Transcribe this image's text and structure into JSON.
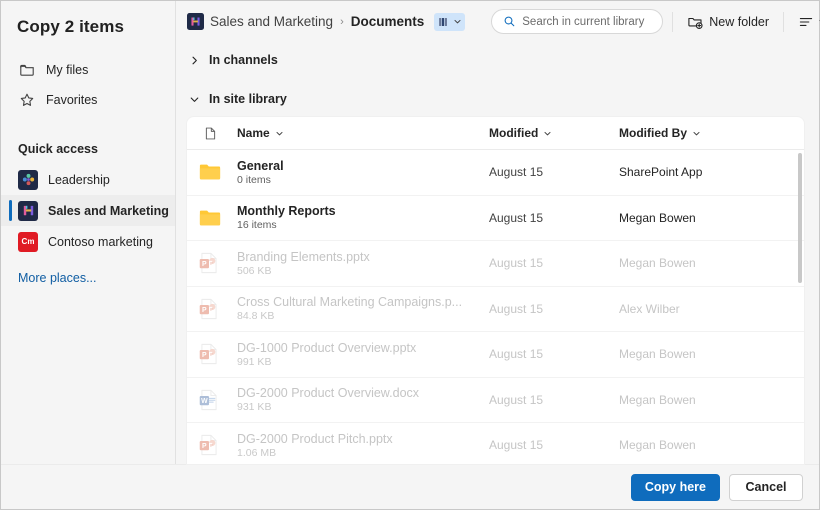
{
  "dialog": {
    "title": "Copy 2 items"
  },
  "sidebar": {
    "nav": [
      {
        "label": "My files",
        "icon": "folder-icon"
      },
      {
        "label": "Favorites",
        "icon": "star-icon"
      }
    ],
    "quick_access_label": "Quick access",
    "quick_access": [
      {
        "label": "Leadership",
        "icon": "team-avatar-leadership",
        "selected": false
      },
      {
        "label": "Sales and Marketing",
        "icon": "team-avatar-sales-marketing",
        "selected": true
      },
      {
        "label": "Contoso marketing",
        "icon": "team-avatar-contoso",
        "initials": "Cm",
        "selected": false
      }
    ],
    "more_places": "More places..."
  },
  "toolbar": {
    "breadcrumb": {
      "site": "Sales and Marketing",
      "separator": "›",
      "current": "Documents",
      "library_switcher_icon": "library-icon",
      "library_chevron_icon": "chevron-down-icon"
    },
    "search": {
      "placeholder": "Search in current library",
      "value": "",
      "icon": "search-icon"
    },
    "new_folder": {
      "label": "New folder",
      "icon": "new-folder-icon"
    },
    "view_options": {
      "icon": "list-view-icon",
      "chevron": "chevron-down-icon"
    }
  },
  "sections": {
    "channels": {
      "label": "In channels",
      "expanded": false,
      "chevron": "chevron-right-icon"
    },
    "site_library": {
      "label": "In site library",
      "expanded": true,
      "chevron": "chevron-down-icon"
    }
  },
  "table": {
    "columns": [
      {
        "key": "icon",
        "label": "",
        "icon": "document-icon"
      },
      {
        "key": "name",
        "label": "Name",
        "sort_icon": "chevron-down-icon"
      },
      {
        "key": "modified",
        "label": "Modified",
        "sort_icon": "chevron-down-icon"
      },
      {
        "key": "modified_by",
        "label": "Modified By",
        "sort_icon": "chevron-down-icon"
      }
    ],
    "rows": [
      {
        "type": "folder",
        "name": "General",
        "sub": "0 items",
        "modified": "August 15",
        "modified_by": "SharePoint App",
        "dim": false
      },
      {
        "type": "folder",
        "name": "Monthly Reports",
        "sub": "16 items",
        "modified": "August 15",
        "modified_by": "Megan Bowen",
        "dim": false
      },
      {
        "type": "pptx",
        "name": "Branding Elements.pptx",
        "sub": "506 KB",
        "modified": "August 15",
        "modified_by": "Megan Bowen",
        "dim": true
      },
      {
        "type": "pptx",
        "name": "Cross Cultural Marketing Campaigns.p...",
        "sub": "84.8 KB",
        "modified": "August 15",
        "modified_by": "Alex Wilber",
        "dim": true
      },
      {
        "type": "pptx",
        "name": "DG-1000 Product Overview.pptx",
        "sub": "991 KB",
        "modified": "August 15",
        "modified_by": "Megan Bowen",
        "dim": true
      },
      {
        "type": "docx",
        "name": "DG-2000 Product Overview.docx",
        "sub": "931 KB",
        "modified": "August 15",
        "modified_by": "Megan Bowen",
        "dim": true
      },
      {
        "type": "pptx",
        "name": "DG-2000 Product Pitch.pptx",
        "sub": "1.06 MB",
        "modified": "August 15",
        "modified_by": "Megan Bowen",
        "dim": true
      }
    ]
  },
  "footer": {
    "primary": "Copy here",
    "secondary": "Cancel"
  },
  "colors": {
    "accent": "#0f6cbd",
    "link": "#115ea3",
    "folder": "#ffc836",
    "powerpoint": "#d35230",
    "word": "#2b579a",
    "contoso_red": "#e01b24",
    "team_navy": "#1f2a47"
  }
}
